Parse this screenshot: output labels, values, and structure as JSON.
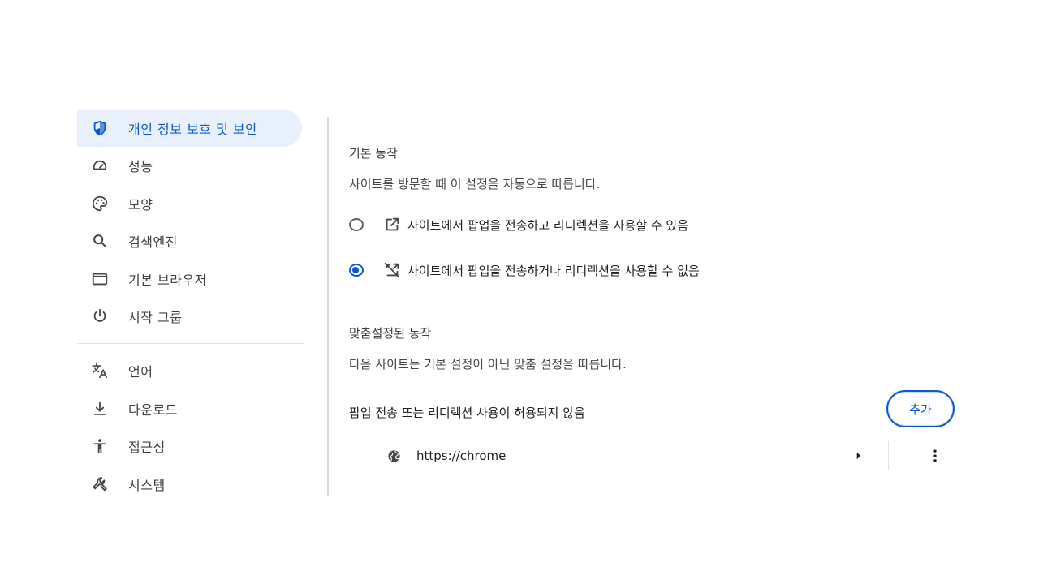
{
  "sidebar": {
    "items": [
      {
        "label": "개인 정보 보호 및 보안",
        "icon": "shield-icon",
        "active": true
      },
      {
        "label": "성능",
        "icon": "speedometer-icon"
      },
      {
        "label": "모양",
        "icon": "palette-icon"
      },
      {
        "label": "검색엔진",
        "icon": "search-icon"
      },
      {
        "label": "기본 브라우저",
        "icon": "browser-window-icon"
      },
      {
        "label": "시작 그룹",
        "icon": "power-icon"
      },
      {
        "label": "언어",
        "icon": "translate-icon"
      },
      {
        "label": "다운로드",
        "icon": "download-icon"
      },
      {
        "label": "접근성",
        "icon": "accessibility-icon"
      },
      {
        "label": "시스템",
        "icon": "wrench-icon"
      }
    ]
  },
  "main": {
    "default_behavior": {
      "title": "기본 동작",
      "description": "사이트를 방문할 때 이 설정을 자동으로 따릅니다.",
      "options": [
        {
          "label": "사이트에서 팝업을 전송하고 리디렉션을 사용할 수 있음",
          "icon": "open-in-new-icon",
          "checked": false
        },
        {
          "label": "사이트에서 팝업을 전송하거나 리디렉션을 사용할 수 없음",
          "icon": "open-in-new-off-icon",
          "checked": true
        }
      ]
    },
    "custom_behavior": {
      "title": "맞춤설정된 동작",
      "description": "다음 사이트는 기본 설정이 아닌 맞춤 설정을 따릅니다.",
      "blocked_list_label": "팝업 전송 또는 리디렉션 사용이 허용되지 않음",
      "add_label": "추가",
      "sites": [
        {
          "url": "https://chrome",
          "icon": "globe-icon"
        }
      ]
    }
  },
  "colors": {
    "accent": "#0b57d0",
    "active_bg": "#e8f0fe",
    "text": "#1f1f1f",
    "muted": "#444746",
    "divider": "#e3e3e3"
  }
}
